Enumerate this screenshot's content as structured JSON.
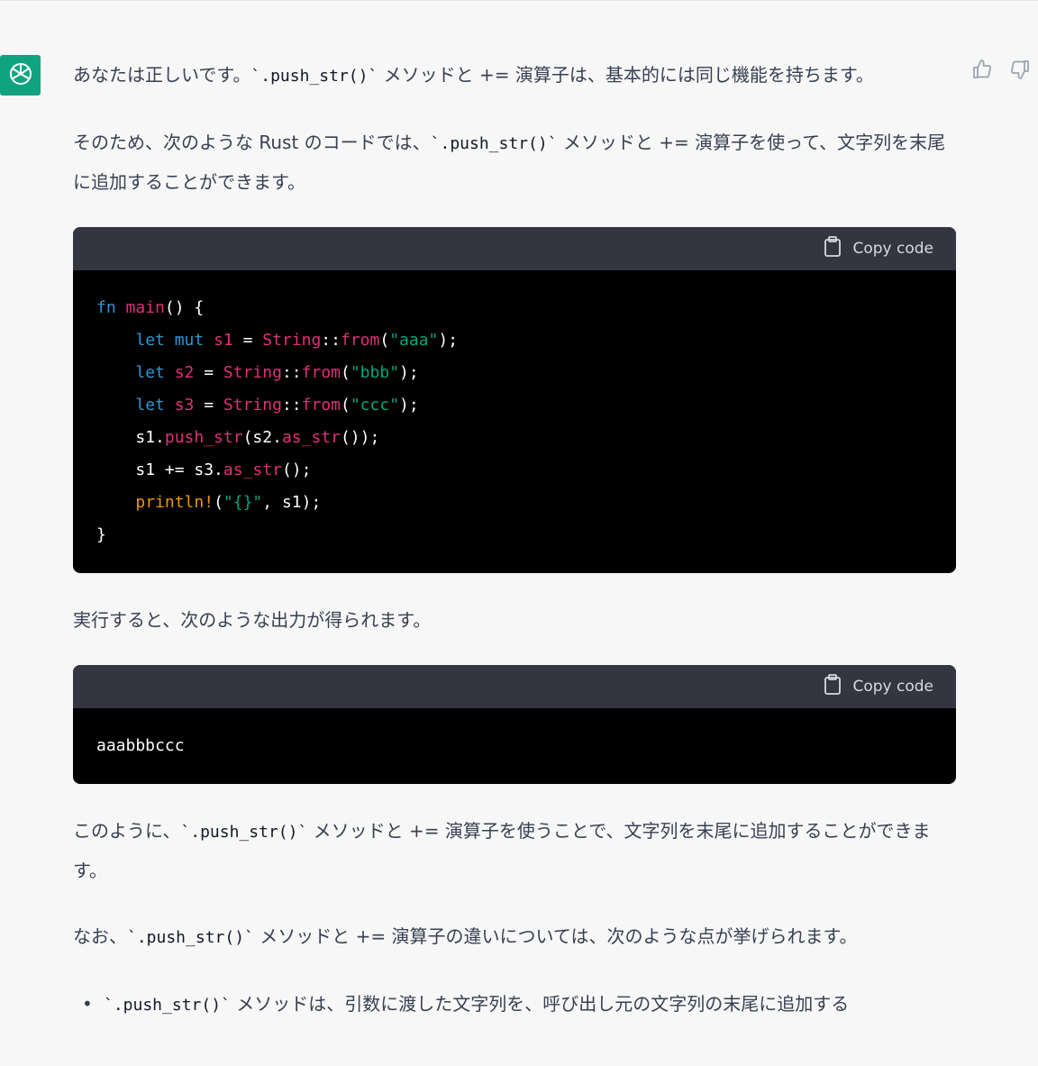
{
  "colors": {
    "assistant_avatar": "#10a37f",
    "code_header_bg": "#343541",
    "code_body_bg": "#000000",
    "keyword": "#2e95d3",
    "function": "#df3079",
    "string": "#00a67d",
    "macro": "#e9950c"
  },
  "icons": {
    "avatar": "openai-logo-icon",
    "thumbs_up": "thumbs-up-icon",
    "thumbs_down": "thumbs-down-icon",
    "copy": "clipboard-icon"
  },
  "message": {
    "p1_a": "あなたは正しいです。",
    "p1_code": "`.push_str()`",
    "p1_b": " メソッドと += 演算子は、基本的には同じ機能を持ちます。",
    "p2_a": "そのため、次のような Rust のコードでは、",
    "p2_code": "`.push_str()`",
    "p2_b": " メソッドと += 演算子を使って、文字列を末尾に追加することができます。",
    "p3": "実行すると、次のような出力が得られます。",
    "p4_a": "このように、",
    "p4_code": "`.push_str()`",
    "p4_b": " メソッドと += 演算子を使うことで、文字列を末尾に追加することができます。",
    "p5_a": "なお、",
    "p5_code": "`.push_str()`",
    "p5_b": " メソッドと += 演算子の違いについては、次のような点が挙げられます。",
    "bullet1_code": "`.push_str()`",
    "bullet1_text": " メソッドは、引数に渡した文字列を、呼び出し元の文字列の末尾に追加する"
  },
  "code_block_1": {
    "copy_label": "Copy code",
    "line1": {
      "kw": "fn",
      "fn": "main",
      "rest": "() {"
    },
    "line2": {
      "kw": "let mut",
      "var": "s1",
      "eq": " = ",
      "type": "String",
      "sep": "::",
      "fn": "from",
      "open": "(",
      "str": "\"aaa\"",
      "close": ");"
    },
    "line3": {
      "kw": "let",
      "var": "s2",
      "eq": " = ",
      "type": "String",
      "sep": "::",
      "fn": "from",
      "open": "(",
      "str": "\"bbb\"",
      "close": ");"
    },
    "line4": {
      "kw": "let",
      "var": "s3",
      "eq": " = ",
      "type": "String",
      "sep": "::",
      "fn": "from",
      "open": "(",
      "str": "\"ccc\"",
      "close": ");"
    },
    "line5": {
      "a": "s1.",
      "fn": "push_str",
      "b": "(s2.",
      "fn2": "as_str",
      "c": "());"
    },
    "line6": {
      "a": "s1 += s3.",
      "fn": "as_str",
      "c": "();"
    },
    "line7": {
      "macro": "println!",
      "open": "(",
      "str": "\"{}\"",
      "rest": ", s1);"
    },
    "line8": "}"
  },
  "code_block_2": {
    "copy_label": "Copy code",
    "output": "aaabbbccc"
  }
}
